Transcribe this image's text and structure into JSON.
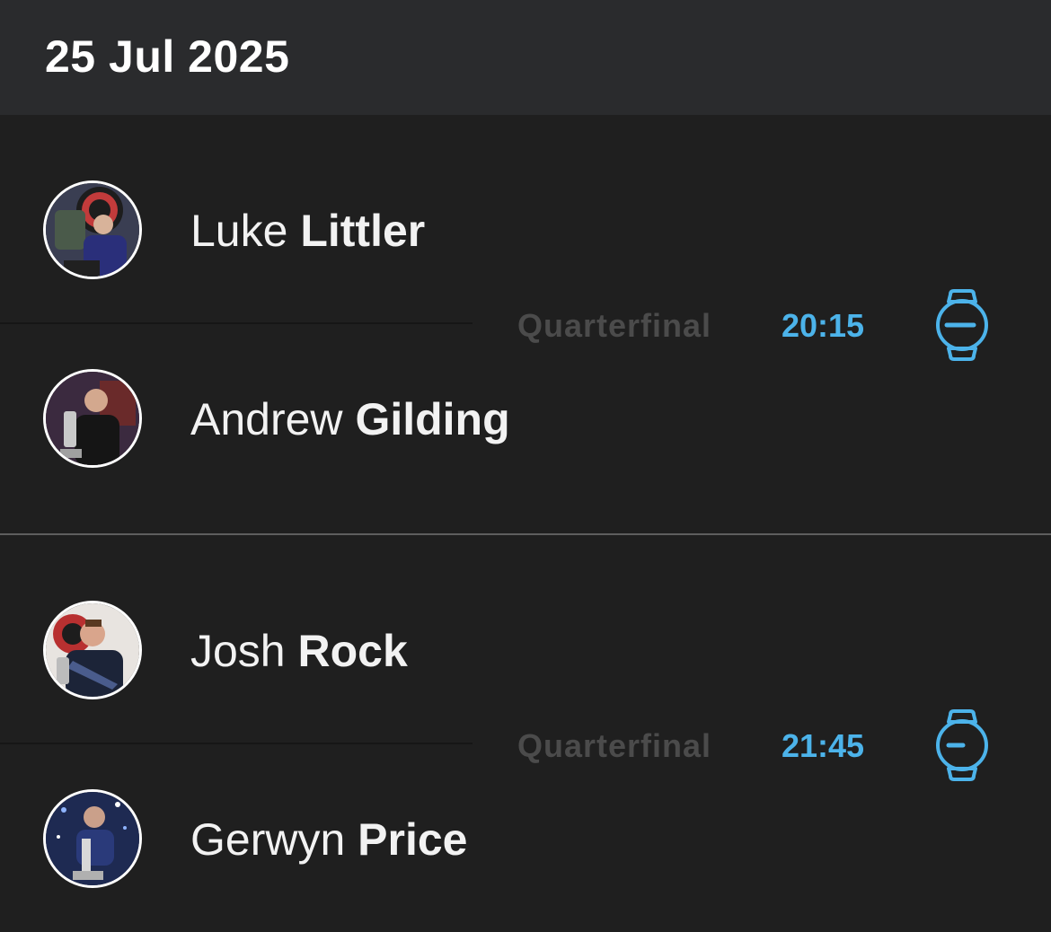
{
  "date": "25 Jul 2025",
  "colors": {
    "accent": "#4cb3ea",
    "background": "#1f1f1f",
    "header_bg": "#2a2b2d",
    "round_label": "#4b4b4b"
  },
  "matches": [
    {
      "round": "Quarterfinal",
      "time": "20:15",
      "icon": "watch-icon",
      "players": [
        {
          "first": "Luke",
          "last": "Littler",
          "avatar": "player-photo"
        },
        {
          "first": "Andrew",
          "last": "Gilding",
          "avatar": "player-photo"
        }
      ]
    },
    {
      "round": "Quarterfinal",
      "time": "21:45",
      "icon": "watch-icon",
      "players": [
        {
          "first": "Josh",
          "last": "Rock",
          "avatar": "player-photo"
        },
        {
          "first": "Gerwyn",
          "last": "Price",
          "avatar": "player-photo"
        }
      ]
    }
  ]
}
